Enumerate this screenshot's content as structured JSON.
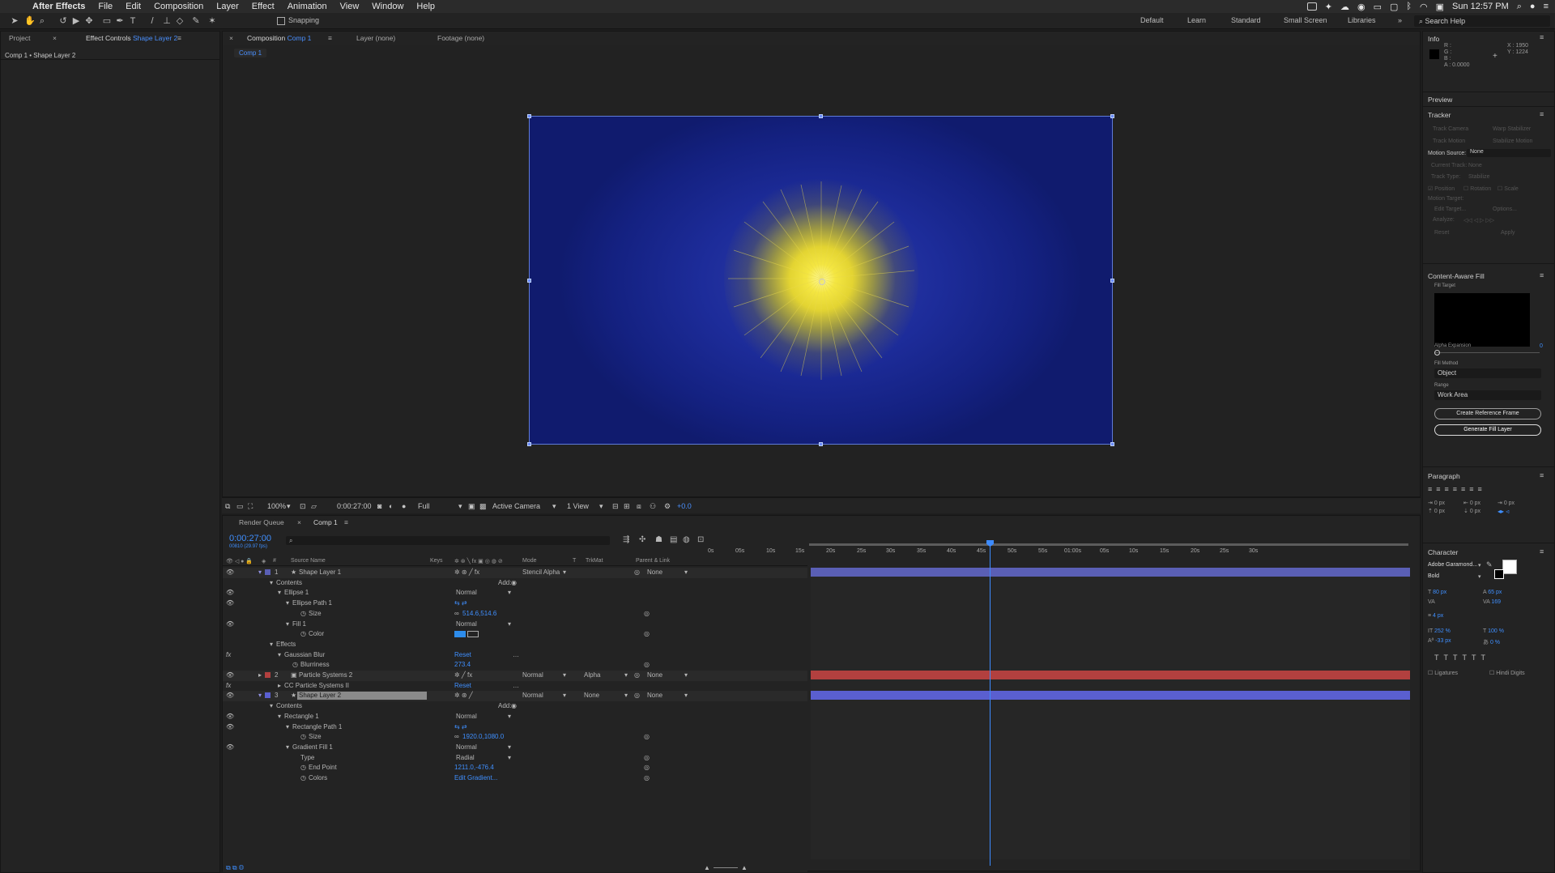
{
  "menubar": {
    "app": "After Effects",
    "items": [
      "File",
      "Edit",
      "Composition",
      "Layer",
      "Effect",
      "Animation",
      "View",
      "Window",
      "Help"
    ],
    "clock": "Sun 12:57 PM"
  },
  "toolbar": {
    "snapping": "Snapping",
    "workspaces": [
      "Default",
      "Learn",
      "Standard",
      "Small Screen",
      "Libraries"
    ],
    "search_placeholder": "Search Help"
  },
  "left_panel": {
    "tab_project": "Project",
    "tab_effect_controls": "Effect Controls",
    "tab_effect_target": "Shape Layer 2",
    "breadcrumb": "Comp 1 • Shape Layer 2"
  },
  "viewer": {
    "tab_composition": "Composition",
    "tab_comp_name": "Comp 1",
    "tab_layer": "Layer (none)",
    "tab_footage": "Footage (none)",
    "subtab": "Comp 1",
    "zoom": "100%",
    "timecode": "0:00:27:00",
    "resolution": "Full",
    "camera": "Active Camera",
    "views": "1 View",
    "exposure": "+0.0"
  },
  "timeline": {
    "tab_render_queue": "Render Queue",
    "tab_comp": "Comp 1",
    "current_time": "0:00:27:00",
    "frame_info": "00810 (29.97 fps)",
    "col_source": "Source Name",
    "col_keys": "Keys",
    "col_mode": "Mode",
    "col_t": "T",
    "col_trkmat": "TrkMat",
    "col_parent": "Parent & Link",
    "ruler": [
      "0s",
      "05s",
      "10s",
      "15s",
      "20s",
      "25s",
      "30s",
      "35s",
      "40s",
      "45s",
      "50s",
      "55s",
      "01:00s",
      "05s",
      "10s",
      "15s",
      "20s",
      "25s",
      "30s"
    ],
    "layers": {
      "l1_num": "1",
      "l1_name": "Shape Layer 1",
      "l1_mode": "Stencil Alpha",
      "l1_parent": "None",
      "contents": "Contents",
      "add": "Add:",
      "ellipse1": "Ellipse 1",
      "ellipse1_mode": "Normal",
      "ellipse_path": "Ellipse Path 1",
      "size": "Size",
      "ellipse_size": "514.6,514.6",
      "fill1": "Fill 1",
      "fill1_mode": "Normal",
      "color": "Color",
      "effects": "Effects",
      "gaussian": "Gaussian Blur",
      "reset": "Reset",
      "blurriness": "Blurriness",
      "blurriness_val": "273.4",
      "l2_num": "2",
      "l2_name": "Particle Systems 2",
      "l2_mode": "Normal",
      "l2_trkmat": "Alpha",
      "l2_parent": "None",
      "cc_particle": "CC Particle Systems II",
      "cc_reset": "Reset",
      "l3_num": "3",
      "l3_name": "Shape Layer 2",
      "l3_mode": "Normal",
      "l3_trkmat": "None",
      "l3_parent": "None",
      "contents2": "Contents",
      "add2": "Add:",
      "rect1": "Rectangle 1",
      "rect1_mode": "Normal",
      "rect_path": "Rectangle Path 1",
      "size2": "Size",
      "rect_size": "1920.0,1080.0",
      "gradient": "Gradient Fill 1",
      "gradient_mode": "Normal",
      "type": "Type",
      "type_val": "Radial",
      "endpoint": "End Point",
      "endpoint_val": "1211.0,-476.4",
      "colors": "Colors",
      "colors_val": "Edit Gradient..."
    }
  },
  "right_panel": {
    "info": "Info",
    "info_r": "R :",
    "info_g": "G :",
    "info_b": "B :",
    "info_a": "A : 0.0000",
    "info_x": "X : 1950",
    "info_y": "Y : 1224",
    "preview": "Preview",
    "tracker": "Tracker",
    "track_camera": "Track Camera",
    "warp_stabilizer": "Warp Stabilizer",
    "track_motion": "Track Motion",
    "stabilize_motion": "Stabilize Motion",
    "motion_source": "Motion Source:",
    "motion_source_val": "None",
    "current_track": "Current Track:",
    "current_track_val": "None",
    "track_type": "Track Type:",
    "track_type_val": "Stabilize",
    "position": "Position",
    "rotation": "Rotation",
    "scale": "Scale",
    "motion_target": "Motion Target:",
    "edit_target": "Edit Target...",
    "options": "Options...",
    "analyze": "Analyze:",
    "reset": "Reset",
    "apply": "Apply",
    "caf": "Content-Aware Fill",
    "fill_target": "Fill Target",
    "alpha_expansion": "Alpha Expansion",
    "alpha_expansion_val": "0",
    "fill_method": "Fill Method",
    "fill_method_val": "Object",
    "range": "Range",
    "range_val": "Work Area",
    "create_ref": "Create Reference Frame",
    "generate": "Generate Fill Layer",
    "paragraph": "Paragraph",
    "para_vals": [
      "0 px",
      "0 px",
      "0 px",
      "0 px",
      "0 px"
    ],
    "character": "Character",
    "font": "Adobe Garamond...",
    "style": "Bold",
    "font_size": "80 px",
    "leading": "65 px",
    "tracking": "169",
    "stroke": "4 px",
    "vscale": "252 %",
    "hscale": "100 %",
    "baseline": "-33 px",
    "tsume": "0 %",
    "ligatures": "Ligatures",
    "hindi": "Hindi Digits"
  },
  "colors": {
    "accent": "#2d8ceb",
    "layer1_bar": "#5a5fb5",
    "layer2_bar": "#b2403f",
    "layer3_bar": "#5a5fd0",
    "playhead": "#3d8bff"
  }
}
